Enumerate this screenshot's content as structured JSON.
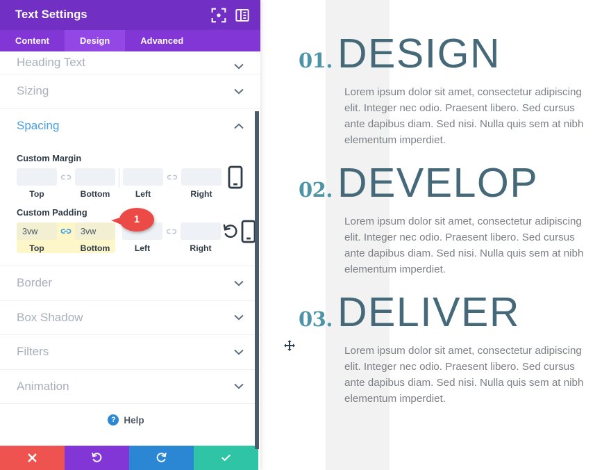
{
  "panel": {
    "title": "Text Settings",
    "header_icons": [
      {
        "name": "focus-icon",
        "label": "focus"
      },
      {
        "name": "layout-toggle-icon",
        "label": "layout"
      }
    ],
    "tabs": [
      {
        "label": "Content",
        "active": false
      },
      {
        "label": "Design",
        "active": true
      },
      {
        "label": "Advanced",
        "active": false
      }
    ],
    "sections": [
      {
        "label": "Heading Text",
        "open": false
      },
      {
        "label": "Sizing",
        "open": false
      },
      {
        "label": "Spacing",
        "open": true
      },
      {
        "label": "Border",
        "open": false
      },
      {
        "label": "Box Shadow",
        "open": false
      },
      {
        "label": "Filters",
        "open": false
      },
      {
        "label": "Animation",
        "open": false
      }
    ],
    "spacing": {
      "margin": {
        "group_label": "Custom Margin",
        "fields": [
          {
            "caption": "Top",
            "value": "",
            "placeholder": ""
          },
          {
            "caption": "Bottom",
            "value": "",
            "placeholder": ""
          },
          {
            "caption": "Left",
            "value": "",
            "placeholder": ""
          },
          {
            "caption": "Right",
            "value": "",
            "placeholder": ""
          }
        ],
        "link_top_bottom": false,
        "link_left_right": false,
        "has_reset": false
      },
      "padding": {
        "group_label": "Custom Padding",
        "fields": [
          {
            "caption": "Top",
            "value": "3vw",
            "placeholder": ""
          },
          {
            "caption": "Bottom",
            "value": "3vw",
            "placeholder": ""
          },
          {
            "caption": "Left",
            "value": "",
            "placeholder": ""
          },
          {
            "caption": "Right",
            "value": "",
            "placeholder": ""
          }
        ],
        "link_top_bottom": true,
        "link_left_right": false,
        "has_reset": true
      }
    },
    "callout": {
      "number": "1"
    },
    "help": {
      "label": "Help"
    },
    "footer": [
      {
        "name": "cancel",
        "icon": "close-icon",
        "color": "#ef5350"
      },
      {
        "name": "undo",
        "icon": "undo-icon",
        "color": "#8236d6"
      },
      {
        "name": "redo",
        "icon": "redo-icon",
        "color": "#2b87d3"
      },
      {
        "name": "save",
        "icon": "check-icon",
        "color": "#2ec4a5"
      }
    ],
    "colors": {
      "header": "#7130c3",
      "tabs": "#8236d6",
      "tab_active": "#9348e6",
      "accent_open": "#4a9ee0",
      "highlight": "#fcf6c9",
      "callout": "#ec4a47"
    }
  },
  "preview": {
    "body_text": "Lorem ipsum dolor sit amet, consectetur adipiscing elit. Integer nec odio. Praesent libero. Sed cursus ante dapibus diam. Sed nisi. Nulla quis sem at nibh elementum imperdiet.",
    "blocks": [
      {
        "number": "01.",
        "title": "DESIGN"
      },
      {
        "number": "02.",
        "title": "DEVELOP"
      },
      {
        "number": "03.",
        "title": "DELIVER"
      }
    ],
    "colors": {
      "number": "#4e94a8",
      "title": "#46697a",
      "body": "#7c7f85",
      "band": "#f2f2f2"
    }
  }
}
